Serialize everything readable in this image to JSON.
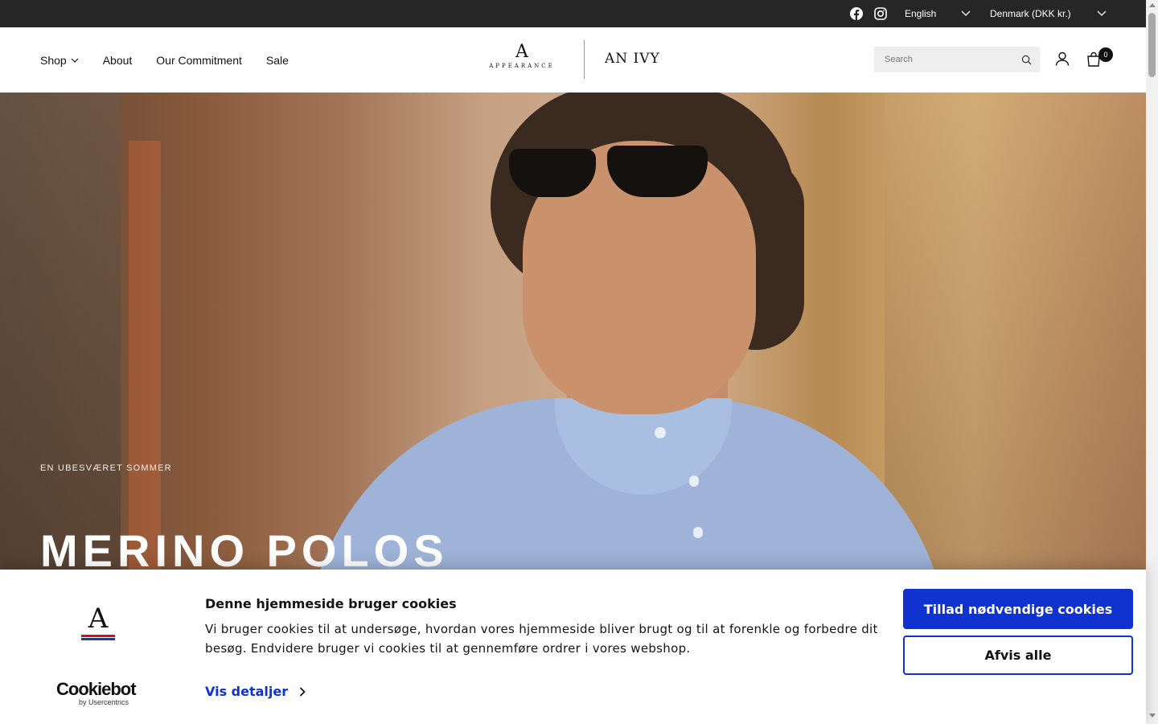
{
  "topbar": {
    "language": "English",
    "country": "Denmark (DKK kr.)",
    "icons": [
      "facebook-icon",
      "instagram-icon",
      "chevron-down-icon"
    ]
  },
  "header": {
    "nav": {
      "shop": "Shop",
      "about": "About",
      "commitment": "Our Commitment",
      "sale": "Sale"
    },
    "logo": {
      "mark": "A",
      "wordmark": "APPEARANCE",
      "partner": "AN IVY"
    },
    "search": {
      "placeholder": "Search"
    },
    "cart": {
      "count": "0"
    }
  },
  "hero": {
    "eyebrow": "EN UBESVÆRET SOMMER",
    "title": "MERINO POLOS"
  },
  "cookie_banner": {
    "logo_mark": "A",
    "provider_name": "Cookiebot",
    "provider_by": "by Usercentrics",
    "heading": "Denne hjemmeside bruger cookies",
    "body": "Vi bruger cookies til at undersøge, hvordan vores hjemmeside bliver brugt og til at forenkle og forbedre dit besøg. Endvidere bruger vi cookies til at gennemføre ordrer i vores webshop.",
    "details_link": "Vis detaljer",
    "allow_button": "Tillad nødvendige cookies",
    "deny_button": "Afvis alle"
  },
  "colors": {
    "topbar_bg": "#262626",
    "accent_blue": "#1032cf",
    "stripe_red": "#c8102e",
    "stripe_blue": "#1f3a93"
  }
}
